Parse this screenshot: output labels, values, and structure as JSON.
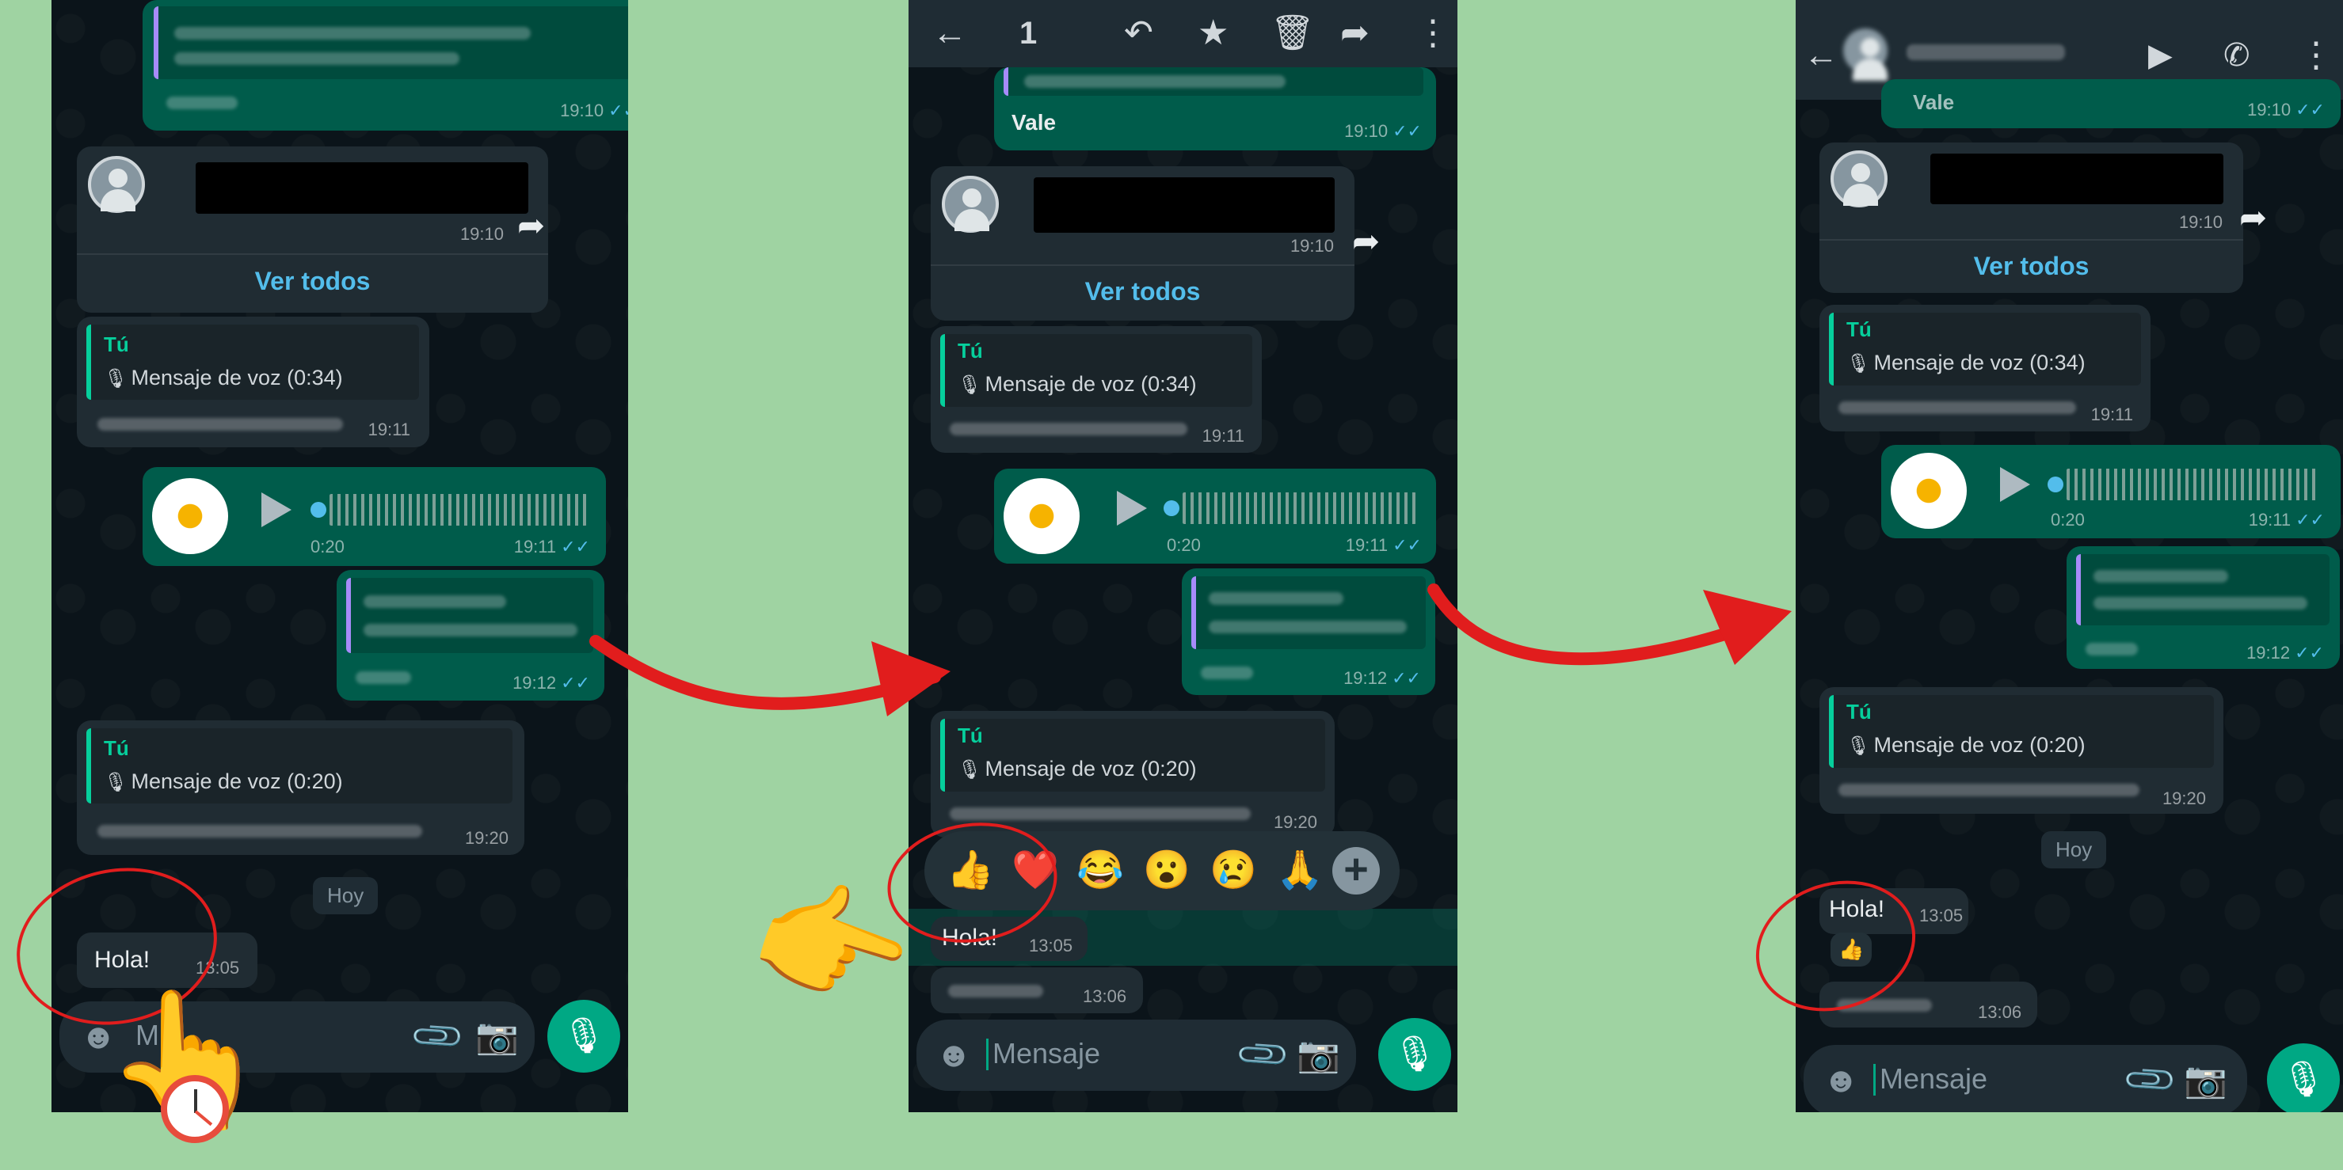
{
  "colors": {
    "background": "#9fd3a2",
    "chat_bg": "#0b141a",
    "outgoing": "#005c4b",
    "incoming": "#202c33",
    "accent": "#00a884",
    "link": "#53bdeb",
    "arrow": "#e11d1d"
  },
  "panel1": {
    "msg_vale_time": "19:10",
    "card_time": "19:10",
    "ver_todos": "Ver todos",
    "reply1_author": "Tú",
    "reply1_quote": "Mensaje de voz (0:34)",
    "reply1_time": "19:11",
    "voice_duration": "0:20",
    "voice_time": "19:11",
    "reply2_time": "19:12",
    "reply3_author": "Tú",
    "reply3_quote": "Mensaje de voz (0:20)",
    "reply3_time": "19:20",
    "day_chip": "Hoy",
    "hola_text": "Hola!",
    "hola_time": "13:05",
    "input_placeholder": "M"
  },
  "panel2": {
    "selected_count": "1",
    "vale_text": "Vale",
    "vale_time": "19:10",
    "card_time": "19:10",
    "ver_todos": "Ver todos",
    "reply1_author": "Tú",
    "reply1_quote": "Mensaje de voz (0:34)",
    "reply1_time": "19:11",
    "voice_duration": "0:20",
    "voice_time": "19:11",
    "reply2_time": "19:12",
    "reply3_author": "Tú",
    "reply3_quote": "Mensaje de voz (0:20)",
    "reply3_time": "19:20",
    "reactions": [
      "👍",
      "❤️",
      "😂",
      "😮",
      "😢",
      "🙏"
    ],
    "hola_text": "Hola!",
    "hola_time": "13:05",
    "buenos_time": "13:06",
    "input_placeholder": "Mensaje"
  },
  "panel3": {
    "vale_text": "Vale",
    "vale_time": "19:10",
    "card_time": "19:10",
    "ver_todos": "Ver todos",
    "reply1_author": "Tú",
    "reply1_quote": "Mensaje de voz (0:34)",
    "reply1_time": "19:11",
    "voice_duration": "0:20",
    "voice_time": "19:11",
    "reply2_time": "19:12",
    "reply3_author": "Tú",
    "reply3_quote": "Mensaje de voz (0:20)",
    "reply3_time": "19:20",
    "day_chip": "Hoy",
    "hola_text": "Hola!",
    "hola_time": "13:05",
    "hola_reaction": "👍",
    "buenos_time": "13:06",
    "input_placeholder": "Mensaje"
  },
  "icons": {
    "back": "arrow-left",
    "reply": "reply-arrow",
    "star": "star",
    "delete": "trash",
    "forward": "forward-arrow",
    "more": "vertical-dots",
    "video": "video-camera",
    "call": "phone",
    "emoji": "smiley",
    "attach": "paperclip",
    "camera": "camera",
    "mic": "microphone"
  }
}
